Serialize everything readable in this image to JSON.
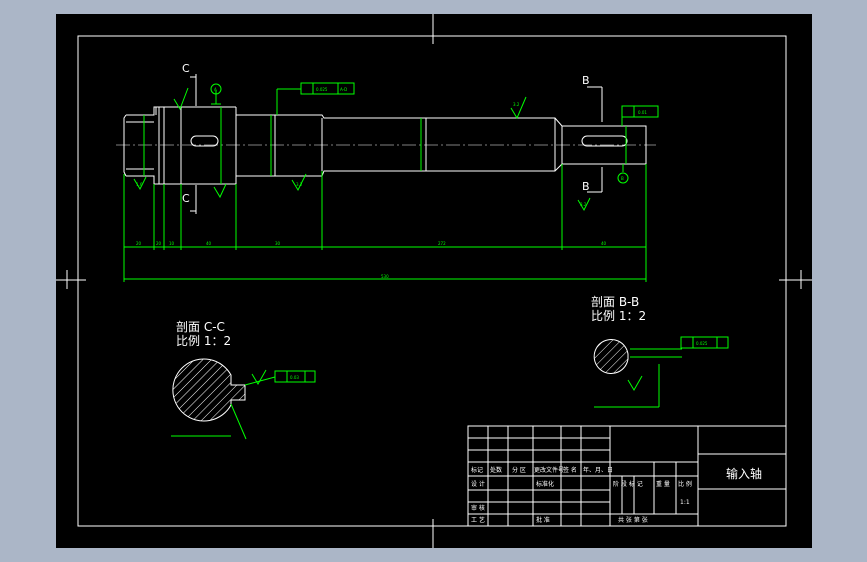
{
  "colors": {
    "background": "#abb6c7",
    "paper": "#000000",
    "line": "#ffffff",
    "dimension": "#00ff00",
    "note": "#ffff00"
  },
  "drawing": {
    "section_c_marker": "C",
    "section_b_marker": "B",
    "datum_a": "A",
    "datum_b": "B",
    "tol_runout": "0.025",
    "tol_datum_ad": "A-D",
    "tol_parallel": "0.01",
    "tol_cc": "0.03",
    "tol_bb": "0.025",
    "roughness_main": "3.2",
    "roughness_shoulder": "3.2",
    "roughness_fine": "1.6",
    "roughness_key": "3.2",
    "dim_seg_1": "20",
    "dim_seg_2": "20",
    "dim_seg_3": "10",
    "dim_seg_4": "40",
    "dim_seg_5": "30",
    "dim_seg_6": "272",
    "dim_seg_7": "40",
    "dim_total": "530"
  },
  "sections": {
    "cc_title": "剖面 C-C",
    "cc_scale": "比例 1：2",
    "bb_title": "剖面 B-B",
    "bb_scale": "比例 1：2"
  },
  "title_block": {
    "part_name": "输入轴",
    "scale_value": "1:1",
    "labels": {
      "mark": "标记",
      "count": "处数",
      "zone": "分 区",
      "change_doc": "更改文件号",
      "sign": "签 名",
      "date": "年、月、日",
      "design": "设 计",
      "standardize": "标准化",
      "stage_mark": "阶 段 标 记",
      "weight": "重 量",
      "scale": "比 例",
      "review": "审 核",
      "process": "工 艺",
      "approve": "批 准",
      "sheet_info": "共  张  第  张"
    }
  }
}
